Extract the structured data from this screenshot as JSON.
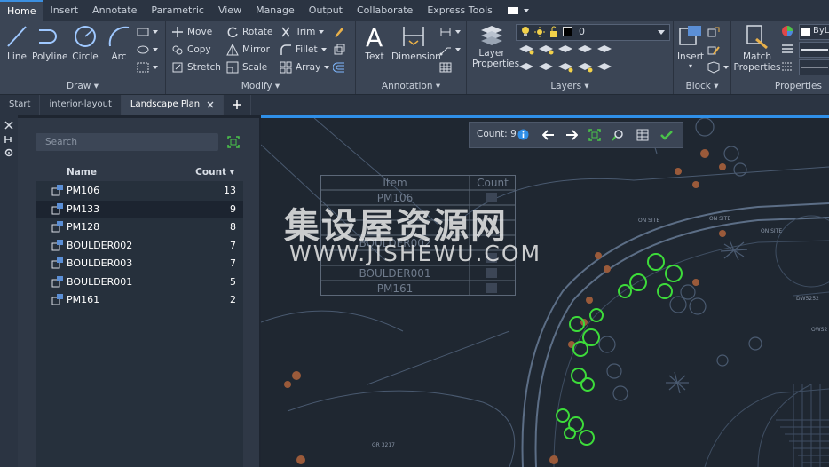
{
  "ribbon_tabs": [
    "Home",
    "Insert",
    "Annotate",
    "Parametric",
    "View",
    "Manage",
    "Output",
    "Collaborate",
    "Express Tools"
  ],
  "panels": {
    "draw": {
      "title": "Draw",
      "tools": [
        "Line",
        "Polyline",
        "Circle",
        "Arc"
      ]
    },
    "modify": {
      "title": "Modify",
      "tools": [
        "Move",
        "Rotate",
        "Trim",
        "Copy",
        "Mirror",
        "Fillet",
        "Stretch",
        "Scale",
        "Array"
      ]
    },
    "annotation": {
      "title": "Annotation",
      "tools": [
        "Text",
        "Dimension"
      ]
    },
    "layers": {
      "title": "Layers",
      "layer_props_line1": "Layer",
      "layer_props_line2": "Properties",
      "current_layer": "0"
    },
    "block": {
      "title": "Block",
      "insert": "Insert"
    },
    "properties": {
      "title": "Properties",
      "match_line1": "Match",
      "match_line2": "Properties",
      "bylayer": "ByL"
    }
  },
  "file_tabs": [
    "Start",
    "interior-layout",
    "Landscape Plan"
  ],
  "count_palette": {
    "search_placeholder": "Search",
    "col_name": "Name",
    "col_count": "Count",
    "rows": [
      {
        "name": "PM106",
        "count": "13"
      },
      {
        "name": "PM133",
        "count": "9"
      },
      {
        "name": "PM128",
        "count": "8"
      },
      {
        "name": "BOULDER002",
        "count": "7"
      },
      {
        "name": "BOULDER003",
        "count": "7"
      },
      {
        "name": "BOULDER001",
        "count": "5"
      },
      {
        "name": "PM161",
        "count": "2"
      }
    ]
  },
  "count_toolbar": {
    "label": "Count:",
    "value": "9"
  },
  "ghost_table": {
    "col_item": "Item",
    "col_count": "Count",
    "rows": [
      "PM106",
      "",
      "",
      "BOULDER002",
      "",
      "BOULDER001",
      "PM161"
    ]
  },
  "drawing_labels": [
    "ON SITE",
    "ON SITE",
    "ON SITE",
    "GR 3217",
    "DW5252",
    "OWS2"
  ],
  "watermark": {
    "line1": "集设屋资源网",
    "line2": "WWW.JISHEWU.COM"
  },
  "colors": {
    "accent": "#2f8fe8",
    "plant": "#3ddc3a",
    "boulder": "#9a5a3a",
    "line": "#5c6e86"
  }
}
